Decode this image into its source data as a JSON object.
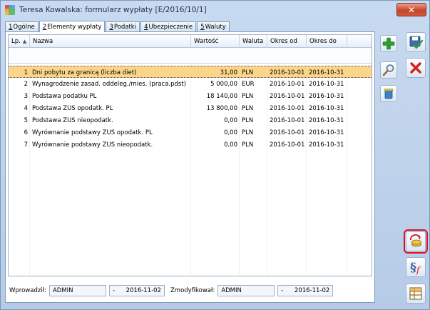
{
  "window": {
    "title": "Teresa Kowalska: formularz wypłaty [E/2016/10/1]",
    "close_label": "✕"
  },
  "tabs": [
    {
      "key": "1",
      "label": "Ogólne",
      "active": false
    },
    {
      "key": "2",
      "label": "Elementy wypłaty",
      "active": true
    },
    {
      "key": "3",
      "label": "Podatki",
      "active": false
    },
    {
      "key": "4",
      "label": "Ubezpieczenie",
      "active": false
    },
    {
      "key": "5",
      "label": "Waluty",
      "active": false
    }
  ],
  "grid": {
    "columns": [
      "Lp.",
      "Nazwa",
      "Wartość",
      "Waluta",
      "Okres od",
      "Okres do"
    ],
    "sort_indicator": "▲",
    "rows": [
      {
        "lp": "1",
        "nazwa": "Dni pobytu za granicą (liczba diet)",
        "wartosc": "31,00",
        "waluta": "PLN",
        "od": "2016-10-01",
        "do": "2016-10-31",
        "selected": true
      },
      {
        "lp": "2",
        "nazwa": "Wynagrodzenie zasad. oddeleg./mies. (praca.pdst)",
        "wartosc": "5 000,00",
        "waluta": "EUR",
        "od": "2016-10-01",
        "do": "2016-10-31",
        "selected": false
      },
      {
        "lp": "3",
        "nazwa": "Podstawa podatku PL",
        "wartosc": "18 140,00",
        "waluta": "PLN",
        "od": "2016-10-01",
        "do": "2016-10-31",
        "selected": false
      },
      {
        "lp": "4",
        "nazwa": "Podstawa ZUS opodatk. PL",
        "wartosc": "13 800,00",
        "waluta": "PLN",
        "od": "2016-10-01",
        "do": "2016-10-31",
        "selected": false
      },
      {
        "lp": "5",
        "nazwa": "Podstawa ZUS nieopodatk.",
        "wartosc": "0,00",
        "waluta": "PLN",
        "od": "2016-10-01",
        "do": "2016-10-31",
        "selected": false
      },
      {
        "lp": "6",
        "nazwa": "Wyrównanie podstawy ZUS opodatk. PL",
        "wartosc": "0,00",
        "waluta": "PLN",
        "od": "2016-10-01",
        "do": "2016-10-31",
        "selected": false
      },
      {
        "lp": "7",
        "nazwa": "Wyrównanie podstawy ZUS nieopodatk.",
        "wartosc": "0,00",
        "waluta": "PLN",
        "od": "2016-10-01",
        "do": "2016-10-31",
        "selected": false
      }
    ]
  },
  "footer": {
    "entered_label": "Wprowadził:",
    "entered_user": "ADMIN",
    "entered_dash": "-",
    "entered_date": "2016-11-02",
    "modified_label": "Zmodyfikował:",
    "modified_user": "ADMIN",
    "modified_dash": "-",
    "modified_date": "2016-11-02"
  },
  "icons": {
    "add": "plus-icon",
    "edit": "magnifier-icon",
    "delete": "trash-icon",
    "save": "save-icon",
    "cancel": "cancel-icon",
    "recalc": "coins-recalculate-icon",
    "formula": "paragraph-formula-icon",
    "table": "table-icon"
  },
  "colors": {
    "selected_row": "#fbd68a",
    "highlight_outline": "#d9142a",
    "cancel_red": "#d21f1f",
    "add_green": "#2fa12f"
  }
}
